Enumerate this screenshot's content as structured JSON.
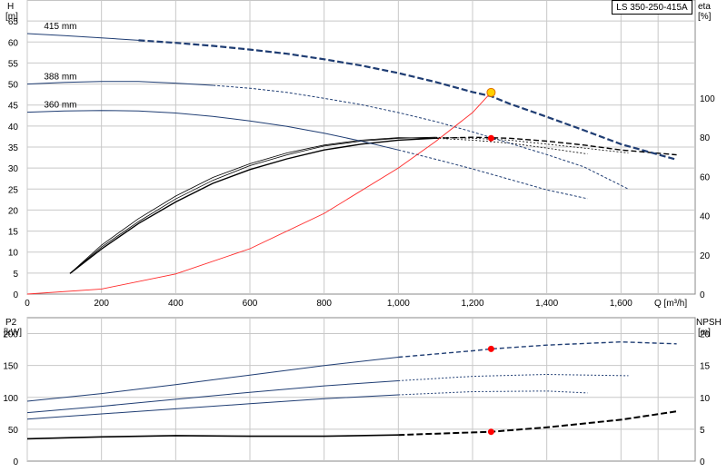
{
  "model_label": "LS 350-250-415A",
  "chart_data": [
    {
      "id": "performance",
      "type": "line",
      "xlabel": "Q [m³/h]",
      "ylabel_left": "H",
      "ylabel_left_unit": "[m]",
      "ylabel_right": "eta",
      "ylabel_right_unit": "[%]",
      "xlim": [
        0,
        1800
      ],
      "ylim_left": [
        0,
        70
      ],
      "ylim_right": [
        0,
        150
      ],
      "x_ticks": [
        0,
        200,
        400,
        600,
        800,
        1000,
        1200,
        1400,
        1600
      ],
      "x_tick_labels": [
        "0",
        "200",
        "400",
        "600",
        "800",
        "1,000",
        "1,200",
        "1,400",
        "1,600"
      ],
      "y_ticks_left": [
        0,
        5,
        10,
        15,
        20,
        25,
        30,
        35,
        40,
        45,
        50,
        55,
        60,
        65
      ],
      "y_ticks_right": [
        0,
        20,
        40,
        60,
        80,
        100
      ],
      "grid": true,
      "head_curves": [
        {
          "name": "415 mm",
          "color": "#1f3d73",
          "points": [
            [
              0,
              62
            ],
            [
              100,
              61.5
            ],
            [
              200,
              61
            ],
            [
              300,
              60.4
            ],
            [
              400,
              59.8
            ],
            [
              500,
              59.1
            ],
            [
              600,
              58.2
            ],
            [
              700,
              57.2
            ],
            [
              800,
              55.9
            ],
            [
              900,
              54.4
            ],
            [
              1000,
              52.6
            ],
            [
              1100,
              50.5
            ],
            [
              1200,
              48.1
            ],
            [
              1250,
              47.1
            ],
            [
              1300,
              45.3
            ],
            [
              1400,
              42.2
            ],
            [
              1500,
              39.0
            ],
            [
              1600,
              35.7
            ],
            [
              1750,
              32.0
            ]
          ],
          "solid_until": 300,
          "bold_from": 300
        },
        {
          "name": "388 mm",
          "color": "#1f3d73",
          "points": [
            [
              0,
              50
            ],
            [
              100,
              50.4
            ],
            [
              200,
              50.6
            ],
            [
              300,
              50.6
            ],
            [
              400,
              50.2
            ],
            [
              500,
              49.7
            ],
            [
              600,
              49
            ],
            [
              700,
              48
            ],
            [
              800,
              46.6
            ],
            [
              900,
              45.1
            ],
            [
              1000,
              43.2
            ],
            [
              1100,
              41.1
            ],
            [
              1200,
              38.6
            ],
            [
              1300,
              35.9
            ],
            [
              1400,
              33.2
            ],
            [
              1500,
              30.3
            ],
            [
              1620,
              25
            ]
          ],
          "solid_until": 500
        },
        {
          "name": "360 mm",
          "color": "#1f3d73",
          "points": [
            [
              0,
              43.3
            ],
            [
              100,
              43.6
            ],
            [
              200,
              43.7
            ],
            [
              300,
              43.6
            ],
            [
              400,
              43.1
            ],
            [
              500,
              42.3
            ],
            [
              600,
              41.2
            ],
            [
              700,
              39.9
            ],
            [
              800,
              38.3
            ],
            [
              900,
              36.4
            ],
            [
              1000,
              34.3
            ],
            [
              1100,
              32.1
            ],
            [
              1200,
              29.8
            ],
            [
              1300,
              27.3
            ],
            [
              1400,
              24.8
            ],
            [
              1510,
              22.7
            ]
          ],
          "solid_until": 1000
        }
      ],
      "efficiency_curves": [
        {
          "name": "",
          "color": "#000000",
          "points": [
            [
              115,
              10.5
            ],
            [
              200,
              23
            ],
            [
              300,
              36
            ],
            [
              400,
              47
            ],
            [
              500,
              56.5
            ],
            [
              600,
              63.5
            ],
            [
              700,
              69
            ],
            [
              800,
              73.5
            ],
            [
              900,
              76.5
            ],
            [
              1000,
              78.5
            ],
            [
              1100,
              79.5
            ],
            [
              1200,
              80
            ],
            [
              1300,
              79.5
            ],
            [
              1400,
              78
            ],
            [
              1500,
              76
            ],
            [
              1600,
              73.5
            ],
            [
              1750,
              71
            ]
          ],
          "bold": true
        },
        {
          "name": "",
          "color": "#000000",
          "points": [
            [
              115,
              10.5
            ],
            [
              200,
              24
            ],
            [
              300,
              37
            ],
            [
              400,
              48.5
            ],
            [
              500,
              58
            ],
            [
              600,
              65.5
            ],
            [
              700,
              71
            ],
            [
              800,
              75.5
            ],
            [
              900,
              78
            ],
            [
              1000,
              79.5
            ],
            [
              1100,
              80
            ],
            [
              1200,
              79.5
            ],
            [
              1300,
              78.5
            ],
            [
              1400,
              76.5
            ],
            [
              1500,
              74.5
            ],
            [
              1620,
              72
            ]
          ]
        },
        {
          "name": "",
          "color": "#000000",
          "points": [
            [
              115,
              10.5
            ],
            [
              200,
              25
            ],
            [
              300,
              38.5
            ],
            [
              400,
              50
            ],
            [
              500,
              59.5
            ],
            [
              600,
              66.5
            ],
            [
              700,
              72
            ],
            [
              800,
              76
            ],
            [
              900,
              78.5
            ],
            [
              1000,
              79.8
            ],
            [
              1100,
              79.5
            ],
            [
              1200,
              78.5
            ],
            [
              1300,
              77
            ],
            [
              1400,
              74.5
            ],
            [
              1510,
              71.5
            ]
          ]
        }
      ],
      "system_curve": {
        "color": "#ff2a2a",
        "points": [
          [
            0,
            0
          ],
          [
            200,
            1.2
          ],
          [
            400,
            4.8
          ],
          [
            600,
            10.8
          ],
          [
            800,
            19.2
          ],
          [
            1000,
            30
          ],
          [
            1100,
            36.3
          ],
          [
            1200,
            43.2
          ],
          [
            1250,
            48
          ]
        ]
      },
      "duty_point": {
        "x": 1250,
        "y": 48,
        "color": "#ffd000"
      },
      "eta_point": {
        "x": 1250,
        "y": 79.5,
        "color": "#ff0000"
      }
    },
    {
      "id": "power_npsh",
      "type": "line",
      "ylabel_left": "P2",
      "ylabel_left_unit": "[kW]",
      "ylabel_right": "NPSH",
      "ylabel_right_unit": "[m]",
      "xlim": [
        0,
        1800
      ],
      "ylim_left": [
        0,
        225
      ],
      "ylim_right": [
        0,
        22.5
      ],
      "y_ticks_left": [
        0,
        50,
        100,
        150,
        200
      ],
      "y_ticks_right": [
        0,
        5,
        10,
        15,
        20
      ],
      "grid": true,
      "power_curves": [
        {
          "name": "415 mm",
          "color": "#1f3d73",
          "points": [
            [
              0,
              94
            ],
            [
              200,
              106
            ],
            [
              400,
              120
            ],
            [
              600,
              135
            ],
            [
              800,
              150
            ],
            [
              1000,
              163
            ],
            [
              1200,
              173
            ],
            [
              1250,
              176
            ],
            [
              1400,
              182
            ],
            [
              1600,
              187
            ],
            [
              1750,
              184
            ]
          ]
        },
        {
          "name": "388 mm",
          "color": "#1f3d73",
          "points": [
            [
              0,
              76
            ],
            [
              200,
              86
            ],
            [
              400,
              97
            ],
            [
              600,
              108
            ],
            [
              800,
              118
            ],
            [
              1000,
              126
            ],
            [
              1200,
              133
            ],
            [
              1400,
              136
            ],
            [
              1620,
              134
            ]
          ]
        },
        {
          "name": "360 mm",
          "color": "#1f3d73",
          "points": [
            [
              0,
              66
            ],
            [
              200,
              74
            ],
            [
              400,
              82
            ],
            [
              600,
              90
            ],
            [
              800,
              98
            ],
            [
              1000,
              104
            ],
            [
              1200,
              109
            ],
            [
              1400,
              110
            ],
            [
              1510,
              107
            ]
          ]
        }
      ],
      "npsh_curve": {
        "color": "#000000",
        "points": [
          [
            0,
            3.5
          ],
          [
            200,
            3.8
          ],
          [
            400,
            4.0
          ],
          [
            600,
            3.9
          ],
          [
            800,
            3.9
          ],
          [
            1000,
            4.1
          ],
          [
            1200,
            4.5
          ],
          [
            1250,
            4.6
          ],
          [
            1400,
            5.3
          ],
          [
            1600,
            6.5
          ],
          [
            1750,
            7.8
          ]
        ]
      },
      "power_point": {
        "x": 1250,
        "y": 176,
        "color": "#ff0000"
      },
      "npsh_point": {
        "x": 1250,
        "y": 4.6,
        "color": "#ff0000"
      }
    }
  ]
}
